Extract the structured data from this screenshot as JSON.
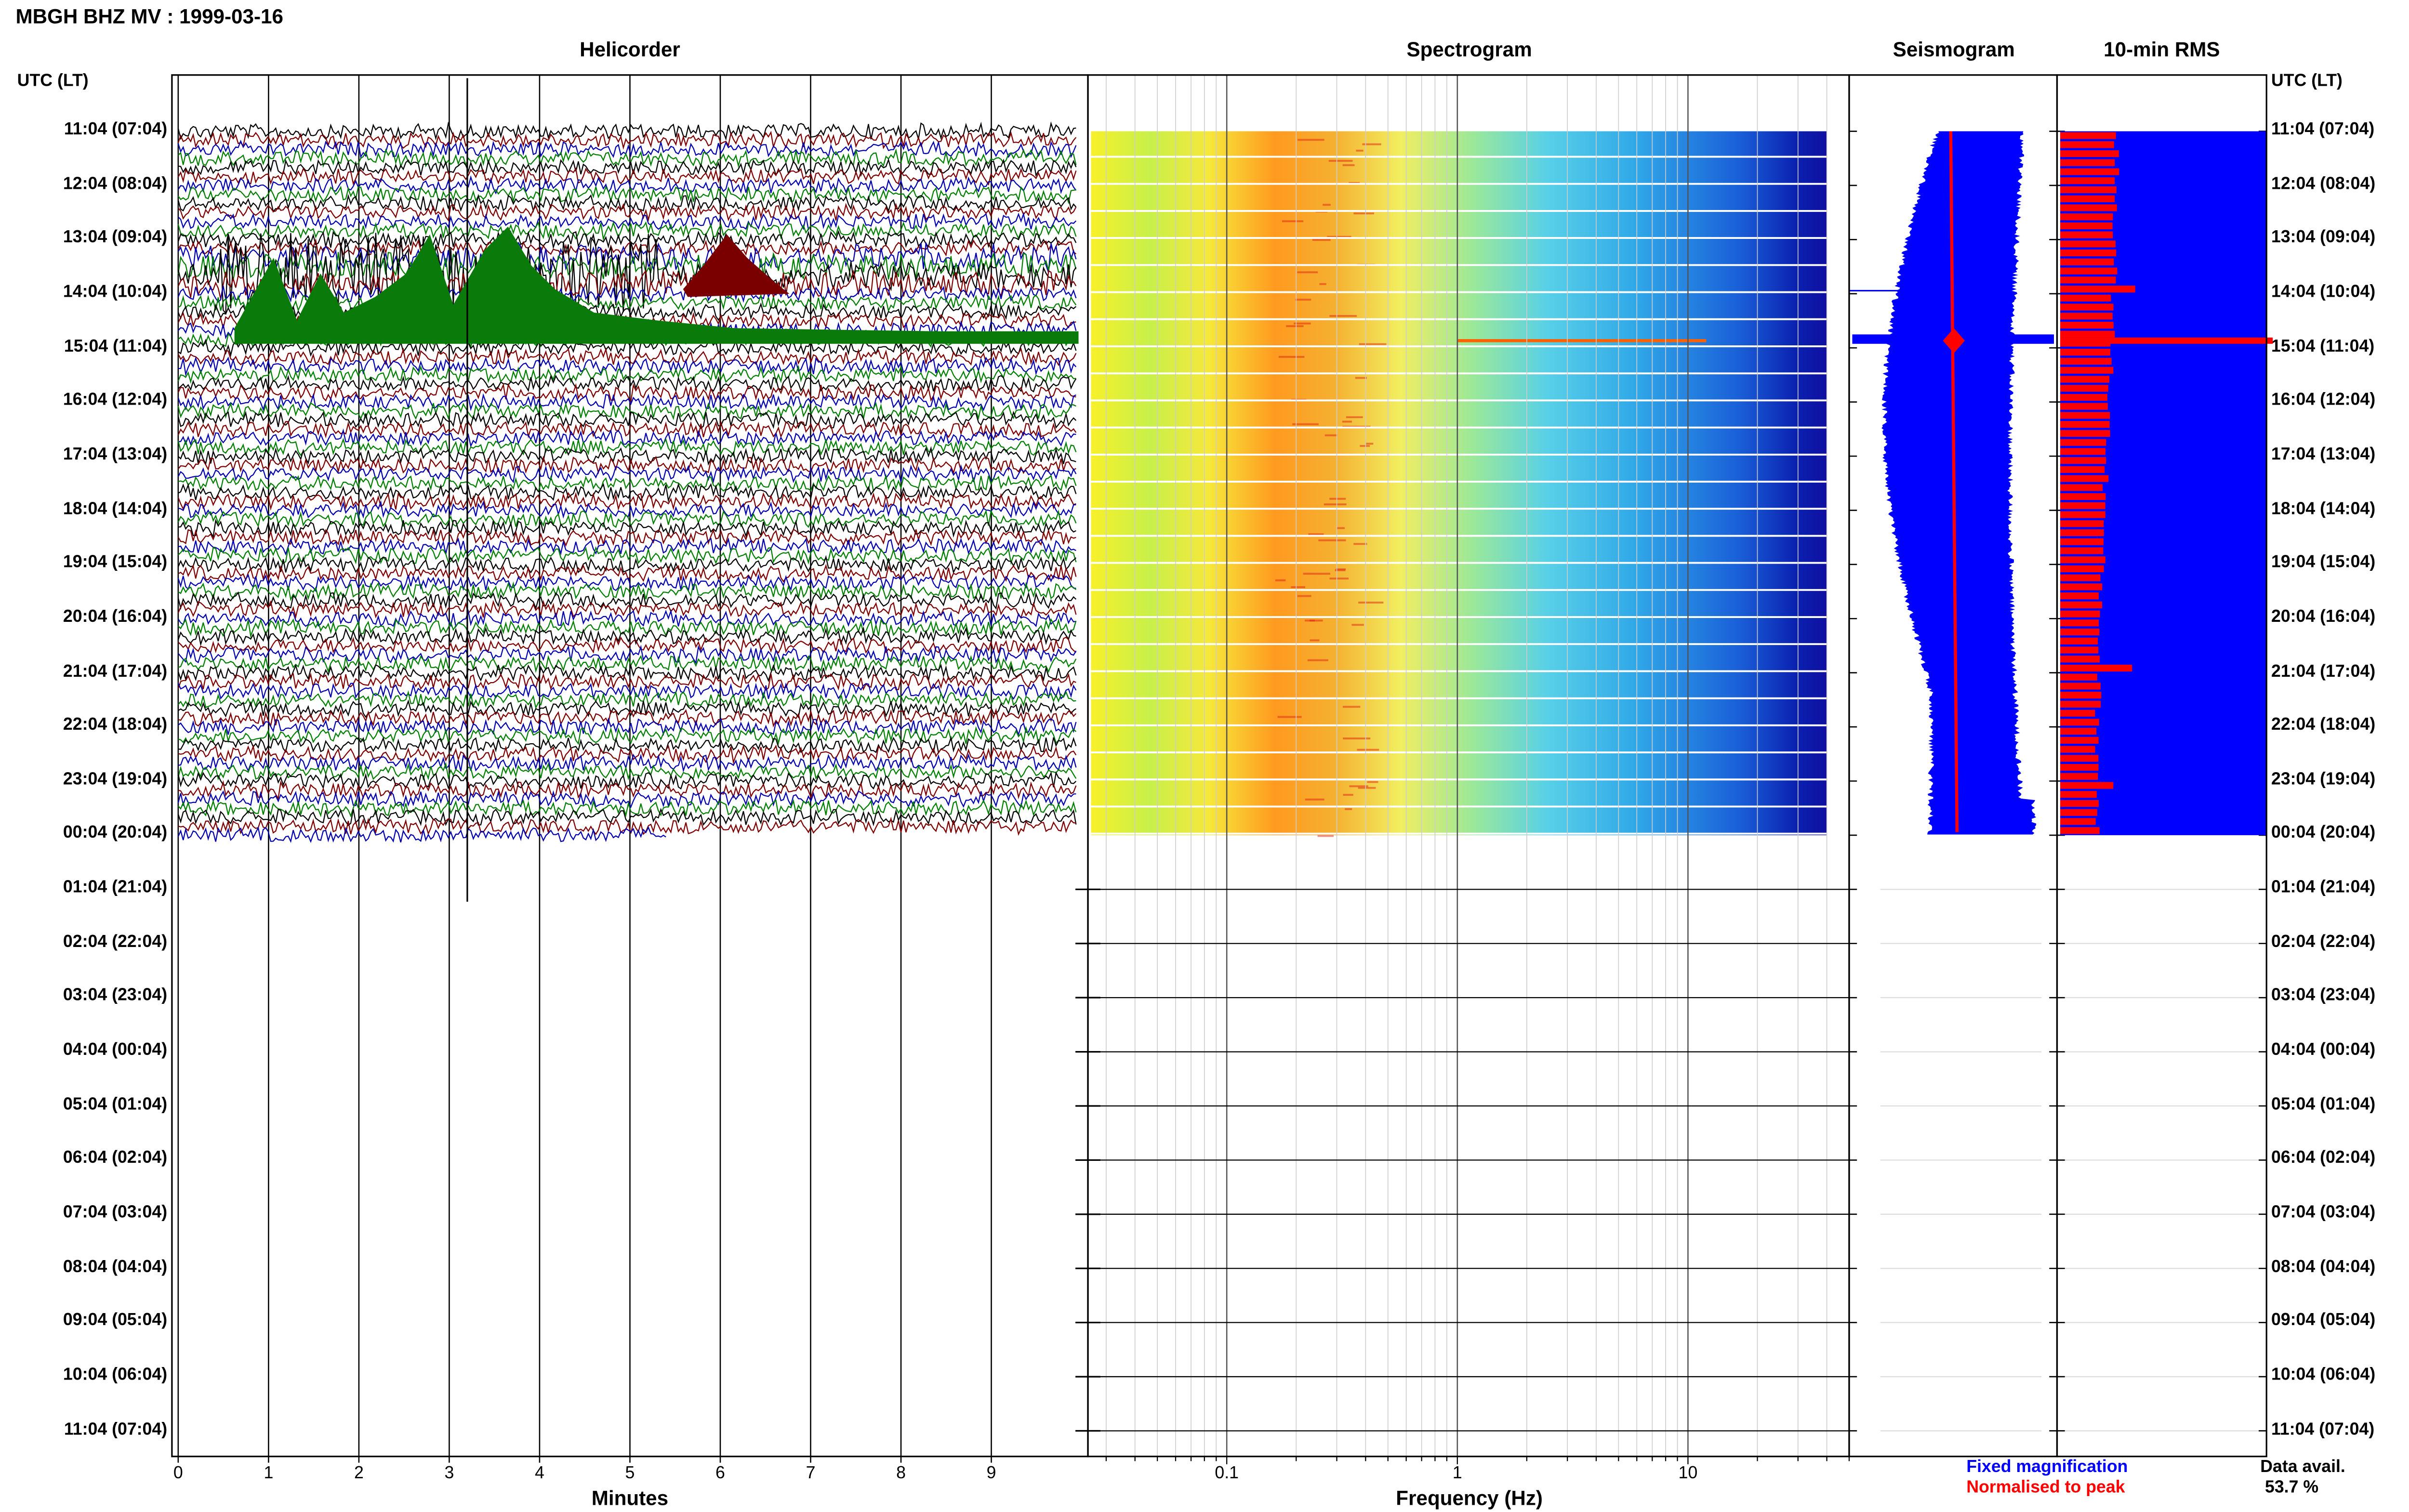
{
  "header": {
    "title": "MBGH BHZ MV : 1999-03-16"
  },
  "panels": {
    "helicorder": "Helicorder",
    "spectrogram": "Spectrogram",
    "seismogram": "Seismogram",
    "rms": "10-min RMS"
  },
  "time_axis": {
    "header_left": "UTC (LT)",
    "header_right": "UTC (LT)",
    "rows": [
      "11:04 (07:04)",
      "12:04 (08:04)",
      "13:04 (09:04)",
      "14:04 (10:04)",
      "15:04 (11:04)",
      "16:04 (12:04)",
      "17:04 (13:04)",
      "18:04 (14:04)",
      "19:04 (15:04)",
      "20:04 (16:04)",
      "21:04 (17:04)",
      "22:04 (18:04)",
      "23:04 (19:04)",
      "00:04 (20:04)",
      "01:04 (21:04)",
      "02:04 (22:04)",
      "03:04 (23:04)",
      "04:04 (00:04)",
      "05:04 (01:04)",
      "06:04 (02:04)",
      "07:04 (03:04)",
      "08:04 (04:04)",
      "09:04 (05:04)",
      "10:04 (06:04)",
      "11:04 (07:04)"
    ]
  },
  "chart_data": [
    {
      "type": "line",
      "title": "Helicorder",
      "xlabel": "Minutes",
      "x_ticks": [
        "0",
        "1",
        "2",
        "3",
        "4",
        "5",
        "6",
        "7",
        "8",
        "9"
      ],
      "xlim": [
        0,
        10
      ],
      "lines_per_hour": 6,
      "data_hours": 13,
      "trace_colors": [
        "#000000",
        "#800000",
        "#0000b0",
        "#008000"
      ]
    },
    {
      "type": "heatmap",
      "title": "Spectrogram",
      "xlabel": "Frequency (Hz)",
      "x_scale": "log",
      "x_ticks": [
        "0.1",
        "1",
        "10"
      ],
      "xlim": [
        0.025,
        50
      ],
      "data_max_hz": 40
    },
    {
      "type": "line",
      "title": "Seismogram",
      "series": [
        {
          "name": "Fixed magnification",
          "color": "#0000ff"
        },
        {
          "name": "Normalised to peak",
          "color": "#ff0000"
        }
      ]
    },
    {
      "type": "bar",
      "title": "10-min RMS",
      "series": [
        {
          "name": "Fixed magnification",
          "color": "#0000ff"
        },
        {
          "name": "Normalised to peak",
          "color": "#ff0000"
        }
      ]
    }
  ],
  "legend": {
    "fixed": "Fixed magnification",
    "normalised": "Normalised to peak"
  },
  "data_availability": {
    "label": "Data avail.",
    "value": "53.7 %"
  },
  "colors": {
    "fixed": "#0000ff",
    "normalised": "#ff0000"
  }
}
